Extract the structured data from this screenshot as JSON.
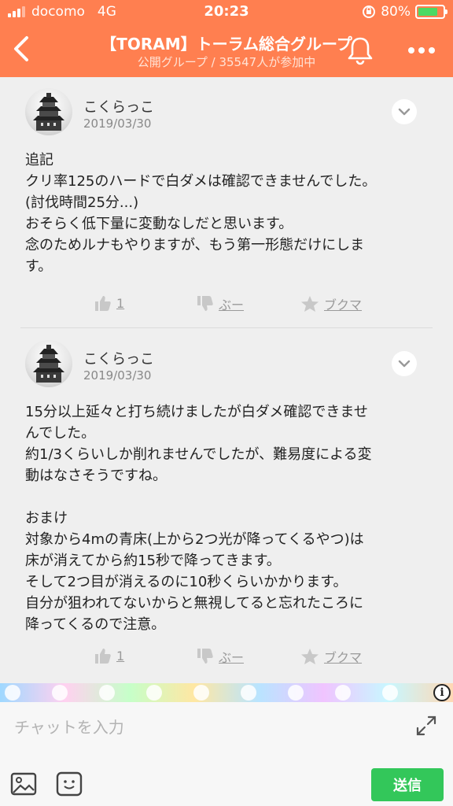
{
  "status_bar": {
    "carrier": "docomo",
    "network": "4G",
    "time": "20:23",
    "battery": "80%",
    "battery_level": 0.8
  },
  "header": {
    "title": "【TORAM】トーラム総合グループ",
    "subtitle": "公開グループ / 35547人が参加中"
  },
  "posts": [
    {
      "author": "こくらっこ",
      "date": "2019/03/30",
      "lines": [
        "追記",
        "クリ率125のハードで白ダメは確認できませんでした。",
        "(討伐時間25分...)",
        "おそらく低下量に変動なしだと思います。",
        "念のためルナもやりますが、もう第一形態だけにしま",
        "す。"
      ],
      "likes": "1",
      "boo": "ぶー",
      "bookmark": "ブクマ"
    },
    {
      "author": "こくらっこ",
      "date": "2019/03/30",
      "lines": [
        "15分以上延々と打ち続けましたが白ダメ確認できませ",
        "んでした。",
        "約1/3くらいしか削れませんでしたが、難易度による変",
        "動はなさそうですね。",
        "",
        "おまけ",
        "対象から4mの青床(上から2つ光が降ってくるやつ)は",
        "床が消えてから約15秒で降ってきます。",
        "そして2つ目が消えるのに10秒くらいかかります。",
        "自分が狙われてないからと無視してると忘れたころに",
        "降ってくるので注意。"
      ],
      "likes": "1",
      "boo": "ぶー",
      "bookmark": "ブクマ"
    }
  ],
  "composer": {
    "placeholder": "チャットを入力",
    "send_label": "送信"
  },
  "colors": {
    "header_bg": "#ff7f50",
    "send_bg": "#33c75a"
  }
}
